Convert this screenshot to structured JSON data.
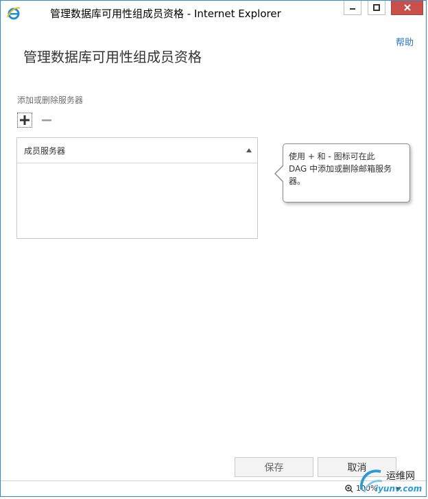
{
  "window": {
    "title": "管理数据库可用性组成员资格 - Internet Explorer"
  },
  "header": {
    "help": "帮助",
    "page_title": "管理数据库可用性组成员资格"
  },
  "servers_section": {
    "label": "添加或删除服务器",
    "column_header": "成员服务器",
    "rows": []
  },
  "tooltip": {
    "text": "使用 + 和 - 图标可在此\nDAG 中添加或删除邮箱服务\n器。"
  },
  "actions": {
    "save": "保存",
    "cancel": "取消"
  },
  "statusbar": {
    "zoom": "100%"
  },
  "watermark": {
    "name": "运维网",
    "url": "iyunv.com"
  },
  "colors": {
    "accent": "#2672c3",
    "close_button": "#c7504b",
    "window_border": "#2b8dcf"
  }
}
